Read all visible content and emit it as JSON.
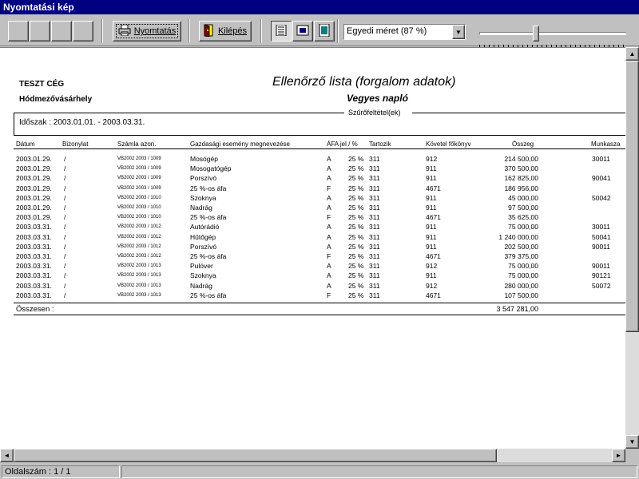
{
  "window": {
    "title": "Nyomtatási kép"
  },
  "toolbar": {
    "print_label": "Nyomtatás",
    "exit_label": "Kilépés",
    "zoom_value": "Egyedi méret (87 %)",
    "zoom_slider_level": 0.38
  },
  "report": {
    "company": "TESZT CÉG",
    "city": "Hódmezővásárhely",
    "title": "Ellenőrző lista (forgalom adatok)",
    "subtitle": "Vegyes napló",
    "filter_label": "Szűrőfeltétel(ek)",
    "period": "Időszak : 2003.01.01. - 2003.03.31.",
    "headers": {
      "date": "Dátum",
      "voucher": "Bizonylat",
      "invoice": "Számla azon.",
      "event": "Gazdasági esemény megnevezése",
      "vat": "ÁFA jel / %",
      "debit": "Tartozik",
      "credit": "Követel főkönyv",
      "amount": "Összeg",
      "job": "Munkasza"
    },
    "rows": [
      {
        "date": "2003.01.29.",
        "voucher": "/",
        "invoice": "VB2002 2003 / 1009",
        "event": "Mosógép",
        "vatcode": "A",
        "vatpct": "25 %",
        "debit": "311",
        "credit": "912",
        "amount": "214 500,00",
        "job": "30011"
      },
      {
        "date": "2003.01.29.",
        "voucher": "/",
        "invoice": "VB2002 2003 / 1009",
        "event": "Mosogatógép",
        "vatcode": "A",
        "vatpct": "25 %",
        "debit": "311",
        "credit": "911",
        "amount": "370 500,00",
        "job": ""
      },
      {
        "date": "2003.01.29.",
        "voucher": "/",
        "invoice": "VB2002 2003 / 1009",
        "event": "Porszívó",
        "vatcode": "A",
        "vatpct": "25 %",
        "debit": "311",
        "credit": "911",
        "amount": "162 825,00",
        "job": "90041"
      },
      {
        "date": "2003.01.29.",
        "voucher": "/",
        "invoice": "VB2002 2003 / 1009",
        "event": "25 %-os áfa",
        "vatcode": "F",
        "vatpct": "25 %",
        "debit": "311",
        "credit": "4671",
        "amount": "186 956,00",
        "job": ""
      },
      {
        "date": "2003.01.29.",
        "voucher": "/",
        "invoice": "VB2002 2003 / 1010",
        "event": "Szoknya",
        "vatcode": "A",
        "vatpct": "25 %",
        "debit": "311",
        "credit": "911",
        "amount": "45 000,00",
        "job": "50042"
      },
      {
        "date": "2003.01.29.",
        "voucher": "/",
        "invoice": "VB2002 2003 / 1010",
        "event": "Nadrág",
        "vatcode": "A",
        "vatpct": "25 %",
        "debit": "311",
        "credit": "911",
        "amount": "97 500,00",
        "job": ""
      },
      {
        "date": "2003.01.29.",
        "voucher": "/",
        "invoice": "VB2002 2003 / 1010",
        "event": "25 %-os áfa",
        "vatcode": "F",
        "vatpct": "25 %",
        "debit": "311",
        "credit": "4671",
        "amount": "35 625,00",
        "job": ""
      },
      {
        "date": "2003.03.31.",
        "voucher": "/",
        "invoice": "VB2002 2003 / 1012",
        "event": "Autórádió",
        "vatcode": "A",
        "vatpct": "25 %",
        "debit": "311",
        "credit": "911",
        "amount": "75 000,00",
        "job": "30011"
      },
      {
        "date": "2003.03.31.",
        "voucher": "/",
        "invoice": "VB2002 2003 / 1012",
        "event": "Hűtőgép",
        "vatcode": "A",
        "vatpct": "25 %",
        "debit": "311",
        "credit": "911",
        "amount": "1 240 000,00",
        "job": "50041"
      },
      {
        "date": "2003.03.31.",
        "voucher": "/",
        "invoice": "VB2002 2003 / 1012",
        "event": "Porszívó",
        "vatcode": "A",
        "vatpct": "25 %",
        "debit": "311",
        "credit": "911",
        "amount": "202 500,00",
        "job": "90011"
      },
      {
        "date": "2003.03.31.",
        "voucher": "/",
        "invoice": "VB2002 2003 / 1012",
        "event": "25 %-os áfa",
        "vatcode": "F",
        "vatpct": "25 %",
        "debit": "311",
        "credit": "4671",
        "amount": "379 375,00",
        "job": ""
      },
      {
        "date": "2003.03.31.",
        "voucher": "/",
        "invoice": "VB2002 2003 / 1013",
        "event": "Pulóver",
        "vatcode": "A",
        "vatpct": "25 %",
        "debit": "311",
        "credit": "912",
        "amount": "75 000,00",
        "job": "90011"
      },
      {
        "date": "2003.03.31.",
        "voucher": "/",
        "invoice": "VB2002 2003 / 1013",
        "event": "Szoknya",
        "vatcode": "A",
        "vatpct": "25 %",
        "debit": "311",
        "credit": "911",
        "amount": "75 000,00",
        "job": "90121"
      },
      {
        "date": "2003.03.31.",
        "voucher": "/",
        "invoice": "VB2002 2003 / 1013",
        "event": "Nadrág",
        "vatcode": "A",
        "vatpct": "25 %",
        "debit": "311",
        "credit": "912",
        "amount": "280 000,00",
        "job": "50072"
      },
      {
        "date": "2003.03.31.",
        "voucher": "/",
        "invoice": "VB2002 2003 / 1013",
        "event": "25 %-os áfa",
        "vatcode": "F",
        "vatpct": "25 %",
        "debit": "311",
        "credit": "4671",
        "amount": "107 500,00",
        "job": ""
      }
    ],
    "total_label": "Összesen :",
    "total_amount": "3 547 281,00"
  },
  "status": {
    "page": "Oldalszám : 1 / 1"
  },
  "icons": {
    "print": "printer-icon",
    "exit": "exit-door-icon",
    "view1": "one-page-view-icon",
    "view2": "page-width-view-icon",
    "view3": "whole-page-view-icon"
  }
}
